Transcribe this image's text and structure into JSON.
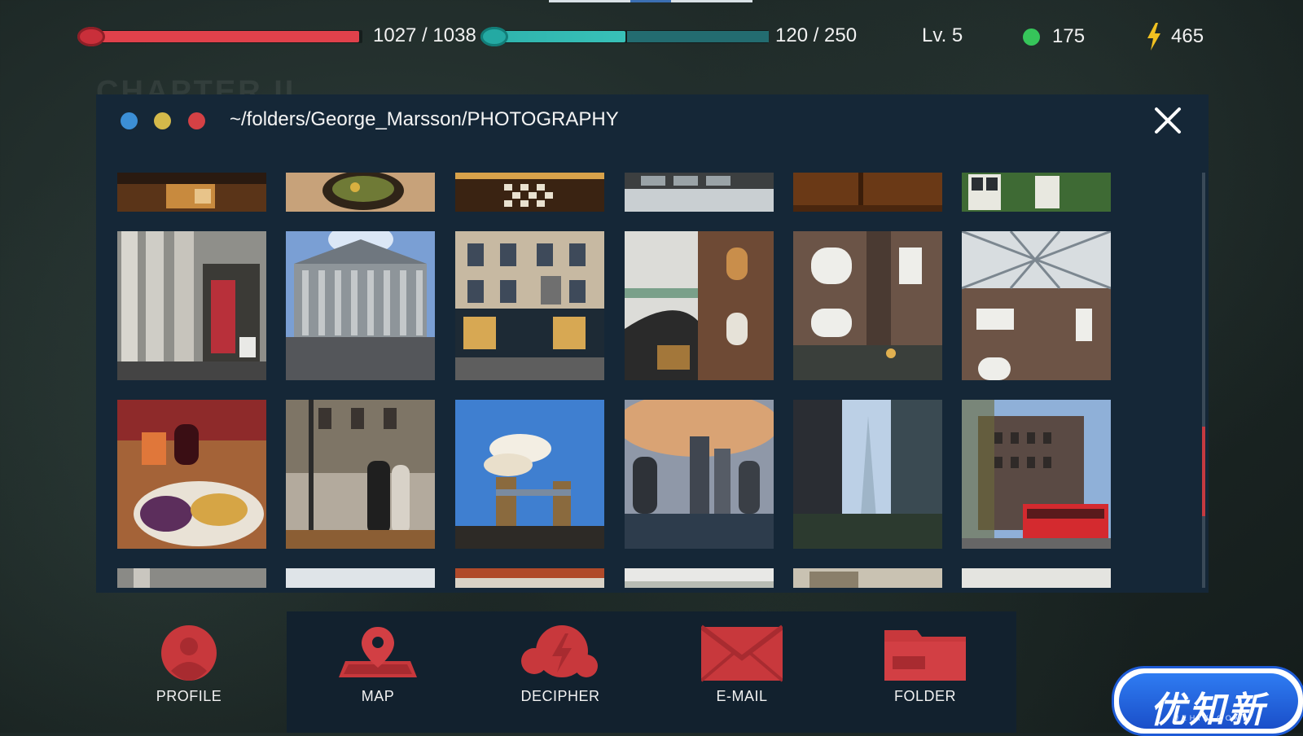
{
  "hud": {
    "health": {
      "current": 1027,
      "max": 1038,
      "text": "1027 / 1038",
      "fraction": 0.989
    },
    "experience": {
      "current": 120,
      "max": 250,
      "text": "120 / 250",
      "fraction": 0.48
    },
    "level": "Lv. 5",
    "coins": "175",
    "energy": "465"
  },
  "background": {
    "chapter_text": "CHAPTER II"
  },
  "window": {
    "path": "~/folders/George_Marsson/PHOTOGRAPHY",
    "controls": [
      "blue",
      "yellow",
      "red"
    ],
    "close_icon": "close-icon",
    "rows": [
      {
        "name": "partial-top",
        "photos": [
          "restaurant-table",
          "food-bowl",
          "checkered-floor",
          "glass-ceiling-hall",
          "wooden-door",
          "window-with-ivy"
        ]
      },
      {
        "name": "row-1",
        "photos": [
          "church-columns",
          "british-museum",
          "pub-storefront",
          "atrium-staircase",
          "brick-atrium",
          "glass-roof-atrium"
        ]
      },
      {
        "name": "row-2",
        "photos": [
          "dinner-plate-wine",
          "street-walkers",
          "tower-bridge",
          "city-skyline",
          "the-shard",
          "red-double-decker-bus"
        ]
      },
      {
        "name": "partial-bottom",
        "photos": [
          "photo-19",
          "photo-20",
          "photo-21",
          "photo-22",
          "photo-23",
          "photo-24"
        ]
      }
    ]
  },
  "dock": {
    "items": [
      {
        "label": "PROFILE",
        "icon": "profile-icon"
      },
      {
        "label": "MAP",
        "icon": "map-pin-icon"
      },
      {
        "label": "DECIPHER",
        "icon": "lightning-cloud-icon"
      },
      {
        "label": "E-MAIL",
        "icon": "envelope-icon"
      },
      {
        "label": "FOLDER",
        "icon": "folder-icon"
      }
    ]
  },
  "watermark": {
    "text": "优知新",
    "sub": "UZHIX.COM"
  },
  "colors": {
    "accent_red": "#e0414b",
    "accent_teal": "#2fb3ad",
    "window_bg": "#152737",
    "coin_green": "#36c55a",
    "energy_yellow": "#f0c020"
  }
}
